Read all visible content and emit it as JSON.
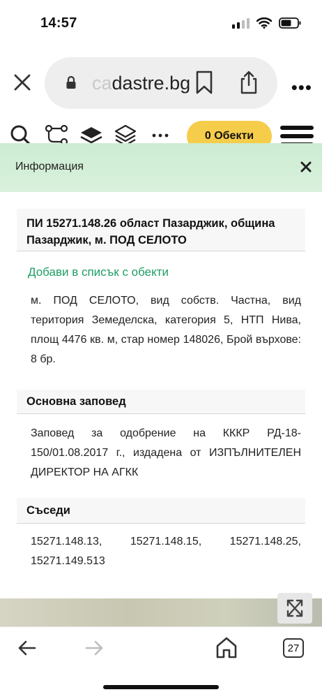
{
  "status": {
    "time": "14:57"
  },
  "browser": {
    "url_faded": "ca",
    "url_main": "dastre.bg",
    "more": "•••"
  },
  "toolbar": {
    "objects_button": "0 Обекти"
  },
  "info": {
    "header_title": "Информация",
    "parcel_title": "ПИ 15271.148.26 област Пазарджик, община Пазарджик, м. ПОД СЕЛОТО",
    "add_link": "Добави в списък с обекти",
    "description": "м. ПОД СЕЛОТО, вид собств. Частна, вид територия Земеделска, категория 5, НТП Нива, площ 4476 кв. м, стар номер 148026, Брой върхове: 8 бр.",
    "order_heading": "Основна заповед",
    "order_text": "Заповед за одобрение на КККР РД-18-150/01.08.2017 г., издадена от ИЗПЪЛНИТЕЛЕН ДИРЕКТОР НА АГКК",
    "neighbors_heading": "Съседи",
    "neighbors_text": "15271.148.13, 15271.148.15, 15271.148.25, 15271.149.513"
  },
  "bottom": {
    "tabs_count": "27"
  },
  "colors": {
    "accent_yellow": "#f6cd4a",
    "link_green": "#1e9e62",
    "header_green": "#d3eed7"
  }
}
